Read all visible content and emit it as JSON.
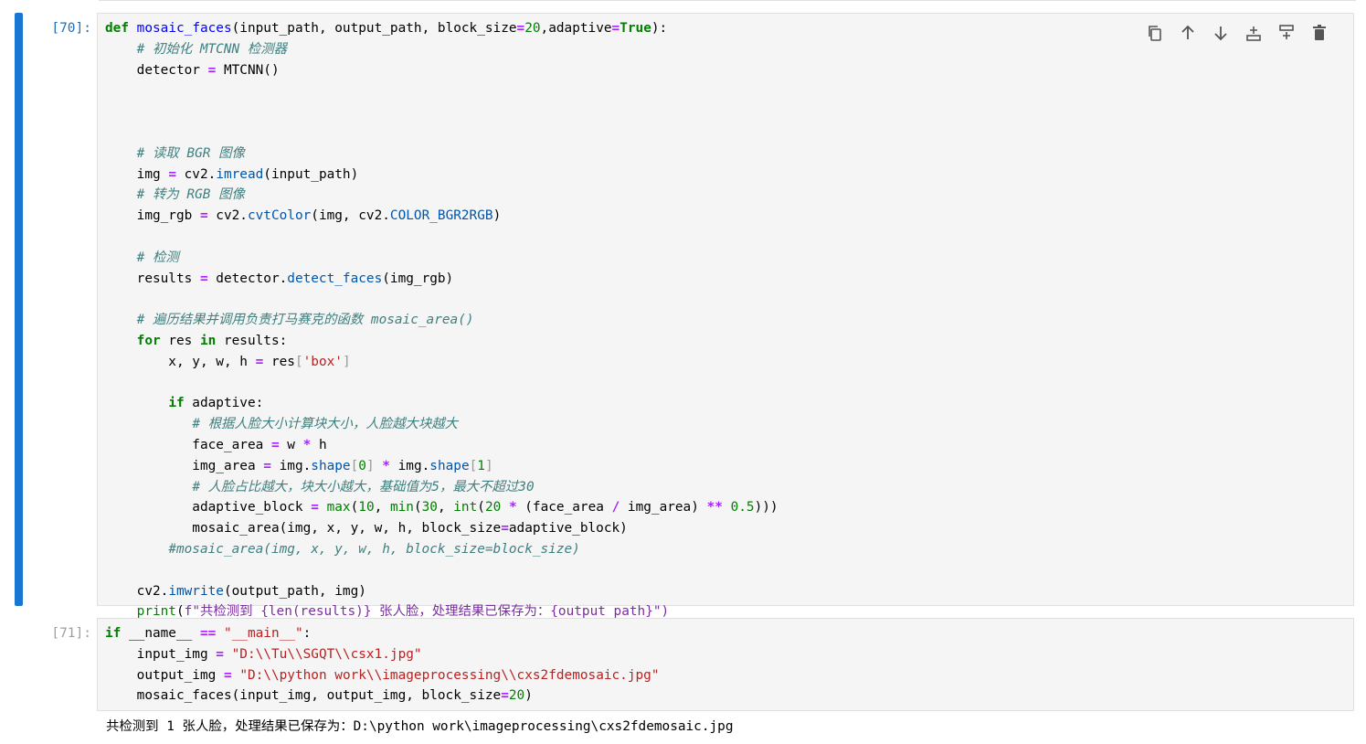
{
  "cells": [
    {
      "prompt": "[70]:",
      "toolbar": [
        "copy-icon",
        "move-up-icon",
        "move-down-icon",
        "insert-above-icon",
        "insert-below-icon",
        "delete-icon"
      ],
      "lines": [
        "def mosaic_faces(input_path, output_path, block_size=20,adaptive=True):",
        "    # 初始化 MTCNN 检测器",
        "    detector = MTCNN()",
        "",
        "",
        "",
        "    # 读取 BGR 图像",
        "    img = cv2.imread(input_path)",
        "    # 转为 RGB 图像",
        "    img_rgb = cv2.cvtColor(img, cv2.COLOR_BGR2RGB)",
        "",
        "    # 检测",
        "    results = detector.detect_faces(img_rgb)",
        "",
        "    # 遍历结果并调用负责打马赛克的函数 mosaic_area()",
        "    for res in results:",
        "        x, y, w, h = res['box']",
        "",
        "        if adaptive:",
        "           # 根据人脸大小计算块大小，人脸越大块越大",
        "           face_area = w * h",
        "           img_area = img.shape[0] * img.shape[1]",
        "           # 人脸占比越大，块大小越大，基础值为5，最大不超过30",
        "           adaptive_block = max(10, min(30, int(20 * (face_area / img_area) ** 0.5)))",
        "           mosaic_area(img, x, y, w, h, block_size=adaptive_block)",
        "        #mosaic_area(img, x, y, w, h, block_size=block_size)",
        "",
        "    cv2.imwrite(output_path, img)",
        "    print(f\"共检测到 {len(results)} 张人脸，处理结果已保存为：{output_path}\")"
      ]
    },
    {
      "prompt": "[71]:",
      "lines": [
        "if __name__ == \"__main__\":",
        "    input_img = \"D:\\\\Tu\\\\SGQT\\\\csx1.jpg\"",
        "    output_img = \"D:\\\\python work\\\\imageprocessing\\\\cxs2fdemosaic.jpg\"",
        "    mosaic_faces(input_img, output_img, block_size=20)"
      ],
      "output": "共检测到 1 张人脸，处理结果已保存为：D:\\python work\\imageprocessing\\cxs2fdemosaic.jpg"
    }
  ],
  "colors": {
    "active_bar": "#1976d2",
    "editor_bg": "#f5f5f5",
    "keyword": "#008000",
    "comment": "#408080",
    "string": "#ba2121",
    "operator": "#aa22ff"
  }
}
